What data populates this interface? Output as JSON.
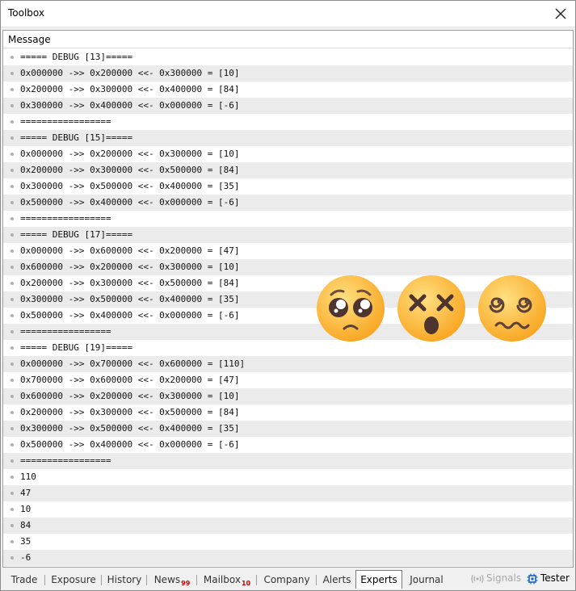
{
  "window": {
    "title": "Toolbox"
  },
  "journal": {
    "column_header": "Message",
    "rows": [
      "===== DEBUG [13]=====",
      "0x000000 ->> 0x200000 <<- 0x300000 = [10]",
      "0x200000 ->> 0x300000 <<- 0x400000 = [84]",
      "0x300000 ->> 0x400000 <<- 0x000000 = [-6]",
      "=================",
      "===== DEBUG [15]=====",
      "0x000000 ->> 0x200000 <<- 0x300000 = [10]",
      "0x200000 ->> 0x300000 <<- 0x500000 = [84]",
      "0x300000 ->> 0x500000 <<- 0x400000 = [35]",
      "0x500000 ->> 0x400000 <<- 0x000000 = [-6]",
      "=================",
      "===== DEBUG [17]=====",
      "0x000000 ->> 0x600000 <<- 0x200000 = [47]",
      "0x600000 ->> 0x200000 <<- 0x300000 = [10]",
      "0x200000 ->> 0x300000 <<- 0x500000 = [84]",
      "0x300000 ->> 0x500000 <<- 0x400000 = [35]",
      "0x500000 ->> 0x400000 <<- 0x000000 = [-6]",
      "=================",
      "===== DEBUG [19]=====",
      "0x000000 ->> 0x700000 <<- 0x600000 = [110]",
      "0x700000 ->> 0x600000 <<- 0x200000 = [47]",
      "0x600000 ->> 0x200000 <<- 0x300000 = [10]",
      "0x200000 ->> 0x300000 <<- 0x500000 = [84]",
      "0x300000 ->> 0x500000 <<- 0x400000 = [35]",
      "0x500000 ->> 0x400000 <<- 0x000000 = [-6]",
      "=================",
      "110",
      "47",
      "10",
      "84",
      "35",
      "-6"
    ]
  },
  "emojis": [
    "pleading-face",
    "face-with-crossed-out-eyes",
    "face-with-spiral-eyes"
  ],
  "tabs": {
    "trade": "Trade",
    "exposure": "Exposure",
    "history": "History",
    "news": "News",
    "news_badge": "99",
    "mailbox": "Mailbox",
    "mailbox_badge": "10",
    "company": "Company",
    "alerts": "Alerts",
    "experts": "Experts",
    "journal": "Journal",
    "active": "Experts"
  },
  "extras": {
    "signals": "Signals",
    "tester": "Tester"
  },
  "colors": {
    "row_alt": "#ebebeb",
    "badge": "#d00000",
    "emoji_yellow": "#fbc02d",
    "tester_blue": "#1565c0"
  }
}
